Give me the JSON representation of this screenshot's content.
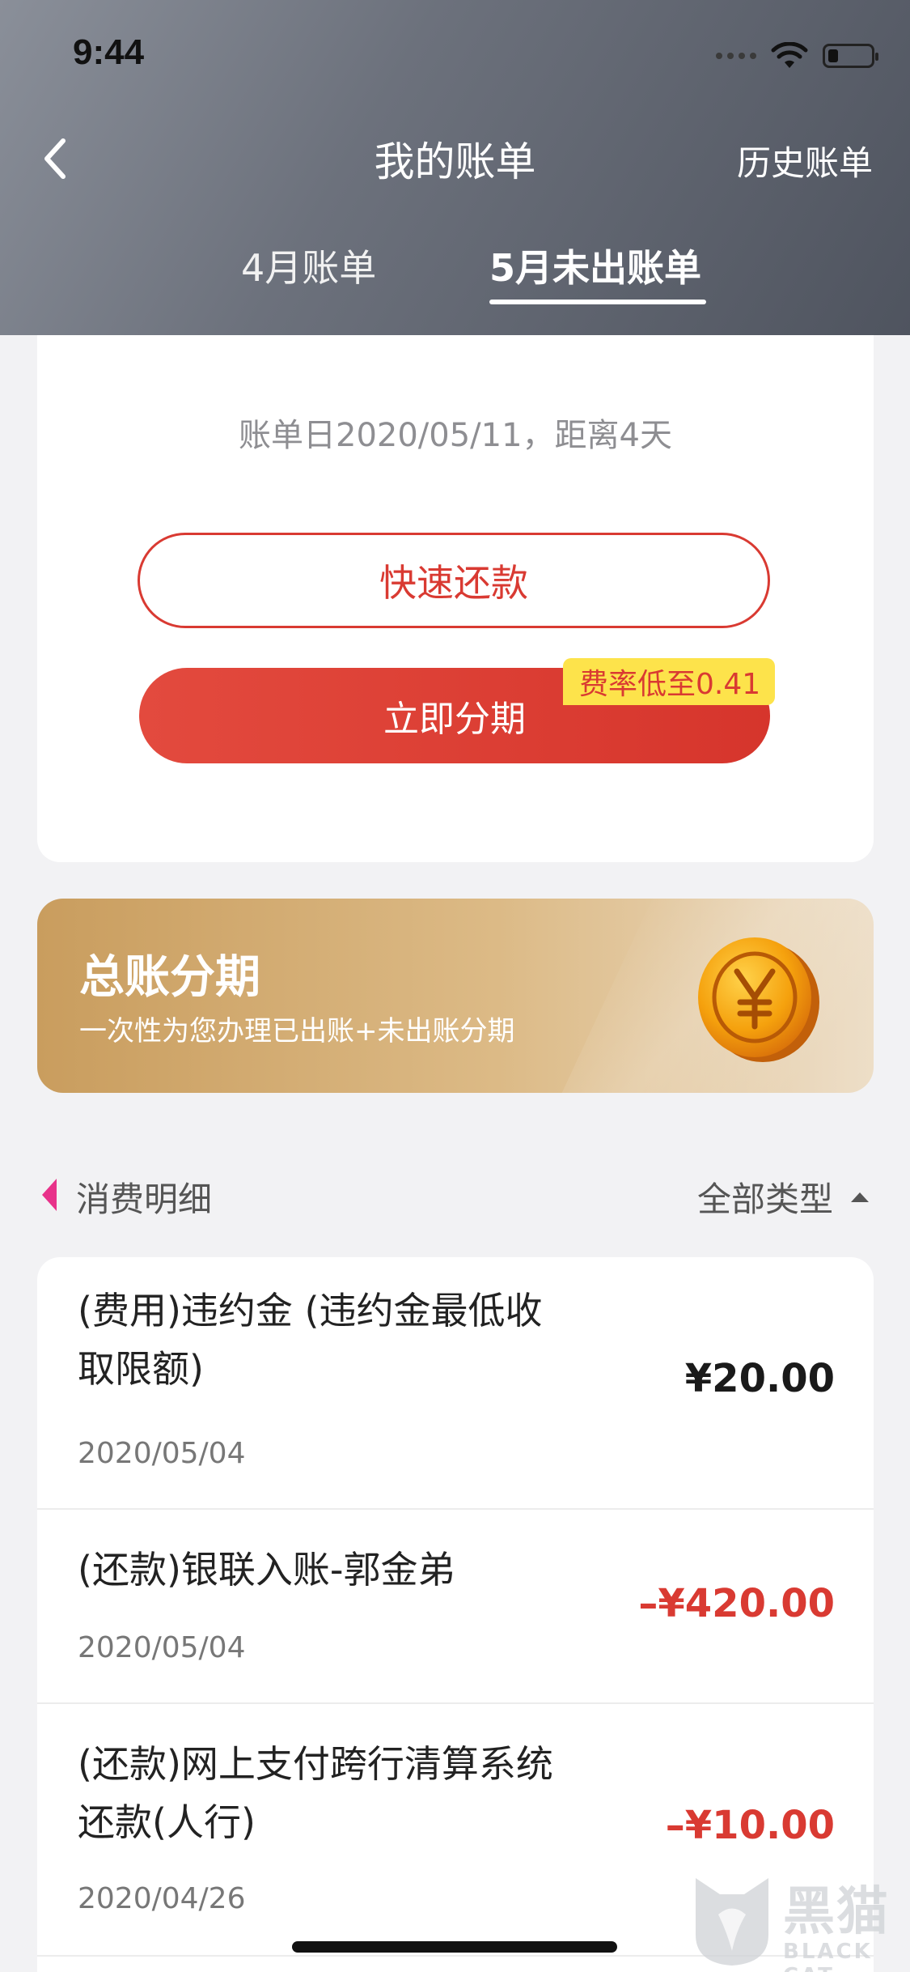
{
  "status_bar": {
    "time": "9:44"
  },
  "nav": {
    "title": "我的账单",
    "history_link": "历史账单"
  },
  "tabs": [
    {
      "label": "4月账单",
      "active": false
    },
    {
      "label": "5月未出账单",
      "active": true
    }
  ],
  "bill": {
    "date_info": "账单日2020/05/11，距离4天",
    "quick_repay_label": "快速还款",
    "installment_label": "立即分期",
    "rate_badge": "费率低至0.41"
  },
  "promo": {
    "title": "总账分期",
    "subtitle": "一次性为您办理已出账+未出账分期",
    "icon": "yuan-coin-icon"
  },
  "details": {
    "title": "消费明细",
    "filter_label": "全部类型"
  },
  "transactions": [
    {
      "description": "(费用)违约金 (违约金最低收取限额)",
      "date": "2020/05/04",
      "amount": "¥20.00"
    },
    {
      "description": "(还款)银联入账-郭金弟",
      "date": "2020/05/04",
      "amount": "–¥420.00"
    },
    {
      "description": "(还款)网上支付跨行清算系统还款(人行)",
      "date": "2020/04/26",
      "amount": "–¥10.00"
    }
  ],
  "watermark": {
    "cn": "黑猫",
    "en": "BLACK CAT"
  },
  "colors": {
    "accent_red": "#d93a32",
    "badge_yellow": "#fde34b",
    "promo_gold": "#c99d5e",
    "section_marker": "#e8328a"
  }
}
